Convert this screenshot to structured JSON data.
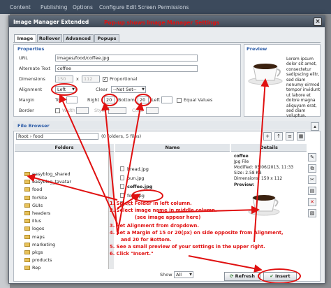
{
  "app": {
    "tabs": [
      "Content",
      "Publishing",
      "Options",
      "Configure Edit Screen",
      "Permissions"
    ]
  },
  "dialog": {
    "title": "Image Manager Extended",
    "close_glyph": "×"
  },
  "annotation_top": "Pop-up shows Image Manager Settings",
  "tabs": [
    "Image",
    "Rollover",
    "Advanced",
    "Popups"
  ],
  "properties": {
    "heading": "Properties",
    "url_label": "URL",
    "url_value": "images/food/coffee.jpg",
    "alt_label": "Alternate Text",
    "alt_value": "coffee",
    "dimensions_label": "Dimensions",
    "width_value": "150",
    "height_value": "112",
    "times": "x",
    "proportional_label": "Proportional",
    "proportional_checked": "✓",
    "alignment_label": "Alignment",
    "alignment_value": "Left",
    "clear_label": "Clear",
    "clear_value": "--Not Set--",
    "margin_label": "Margin",
    "top_label": "Top",
    "right_label": "Right",
    "right_value": "20",
    "bottom_label": "Bottom",
    "bottom_value": "20",
    "left_label": "Left",
    "equal_label": "Equal Values",
    "border_label": "Border",
    "border_width_label": "Width",
    "border_style_label": "Style",
    "border_color_label": "Color"
  },
  "preview": {
    "heading": "Preview",
    "text": "Lorem ipsum dolor sit amet, consectetur sadipscing elitr, sed diam nonumy eirmod tempor invidunt ut labore et dolore magna aliquyam erat, sed diam voluptua."
  },
  "file_browser": {
    "heading": "File Browser",
    "path": "Root › food",
    "count": "(0 folders, 5 files)",
    "folders_header": "Folders",
    "name_header": "Name",
    "details_header": "Details",
    "folders": [
      "easyblog_shared",
      "easyblog_tavatar",
      "food",
      "forSite",
      "GUIs",
      "headers",
      "illus",
      "logos",
      "maps",
      "marketing",
      "pkgs",
      "products",
      "Rep"
    ],
    "files": [
      "bread.jpg",
      "bun.jpg",
      "coffee.jpg",
      "fork.jpg",
      "..."
    ],
    "show_label": "Show",
    "show_value": "All"
  },
  "details": {
    "name": "coffee",
    "type": "Jpg File",
    "modified": "Modified: 05/06/2013, 11:33",
    "size": "Size: 2.58 KB",
    "dimensions": "Dimensions: 150 x 112",
    "preview_label": "Preview:"
  },
  "instructions": [
    "1. Select Folder in left column.",
    "2. Select image name in middle column.",
    "(see image appear here)",
    "3. Set Alignment from dropdown.",
    "4. Set a Margin of 15 or 20(px) on side opposite from Alignment,",
    "and 20 for Bottom.",
    "5. See a small preview of your settings in the upper right.",
    "6. Click \"Insert.\""
  ],
  "buttons": {
    "refresh": "Refresh",
    "insert": "Insert"
  },
  "colors": {
    "annotation": "#e01010",
    "accent": "#2d5da8"
  }
}
